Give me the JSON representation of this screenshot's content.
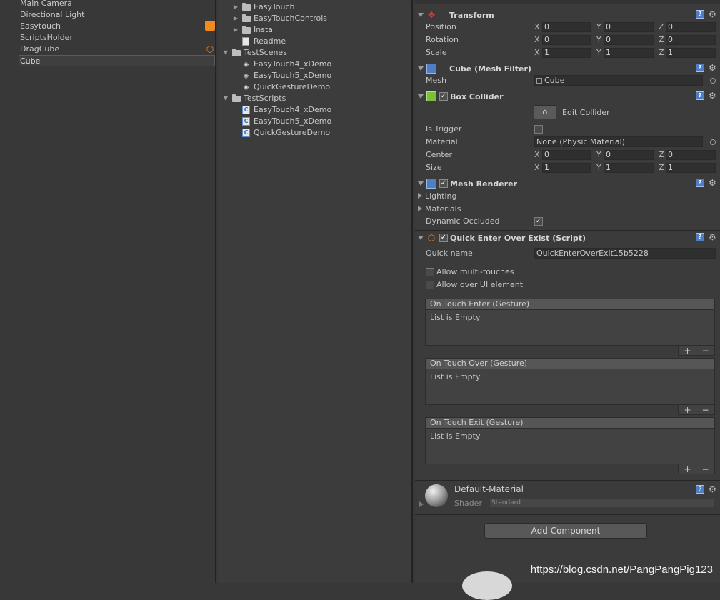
{
  "hierarchy": {
    "items": [
      "Main Camera",
      "Directional Light",
      "Easytouch",
      "ScriptsHolder",
      "DragCube",
      "Cube"
    ]
  },
  "project": {
    "rows": [
      {
        "label": "EasyTouch",
        "kind": "folder",
        "fold": "▶"
      },
      {
        "label": "EasyTouchControls",
        "kind": "folder",
        "fold": "▶"
      },
      {
        "label": "Install",
        "kind": "folder",
        "fold": "▶"
      },
      {
        "label": "Readme",
        "kind": "doc"
      },
      {
        "label": "TestScenes",
        "kind": "folder",
        "fold": "▼"
      },
      {
        "label": "EasyTouch4_xDemo",
        "kind": "scene"
      },
      {
        "label": "EasyTouch5_xDemo",
        "kind": "scene"
      },
      {
        "label": "QuickGestureDemo",
        "kind": "scene"
      },
      {
        "label": "TestScripts",
        "kind": "folder",
        "fold": "▼"
      },
      {
        "label": "EasyTouch4_xDemo",
        "kind": "script"
      },
      {
        "label": "EasyTouch5_xDemo",
        "kind": "script"
      },
      {
        "label": "QuickGestureDemo",
        "kind": "script"
      }
    ]
  },
  "inspector": {
    "transform": {
      "title": "Transform",
      "position_label": "Position",
      "rotation_label": "Rotation",
      "scale_label": "Scale",
      "position": [
        "0",
        "0",
        "0"
      ],
      "rotation": [
        "0",
        "0",
        "0"
      ],
      "scale": [
        "1",
        "1",
        "1"
      ]
    },
    "axes": [
      "X",
      "Y",
      "Z"
    ],
    "mesh_filter": {
      "title": "Cube (Mesh Filter)",
      "mesh_label": "Mesh",
      "mesh_value": "Cube"
    },
    "box_collider": {
      "title": "Box Collider",
      "edit_label": "Edit Collider",
      "is_trigger_label": "Is Trigger",
      "material_label": "Material",
      "material_value": "None (Physic Material)",
      "center_label": "Center",
      "center": [
        "0",
        "0",
        "0"
      ],
      "size_label": "Size",
      "size": [
        "1",
        "1",
        "1"
      ]
    },
    "mesh_renderer": {
      "title": "Mesh Renderer",
      "lighting_label": "Lighting",
      "materials_label": "Materials",
      "dynamic_label": "Dynamic Occluded"
    },
    "script": {
      "title": "Quick Enter Over Exist (Script)",
      "quick_name_label": "Quick name",
      "quick_name_value": "QuickEnterOverExit15b5228",
      "multi_touch_label": "Allow multi-touches",
      "over_ui_label": "Allow over UI element",
      "events": [
        {
          "title": "On Touch Enter (Gesture)",
          "body": "List is Empty"
        },
        {
          "title": "On Touch Over (Gesture)",
          "body": "List is Empty"
        },
        {
          "title": "On Touch Exit (Gesture)",
          "body": "List is Empty"
        }
      ],
      "plus": "+",
      "minus": "−"
    },
    "material": {
      "title": "Default-Material",
      "shader_label": "Shader",
      "shader_value": "Standard"
    },
    "add_component_label": "Add Component"
  },
  "watermark": "https://blog.csdn.net/PangPangPig123",
  "colors": {
    "orange": "#f08a1e",
    "blue_icon": "#4f7ec4",
    "green_collider": "#7bbf3a"
  }
}
